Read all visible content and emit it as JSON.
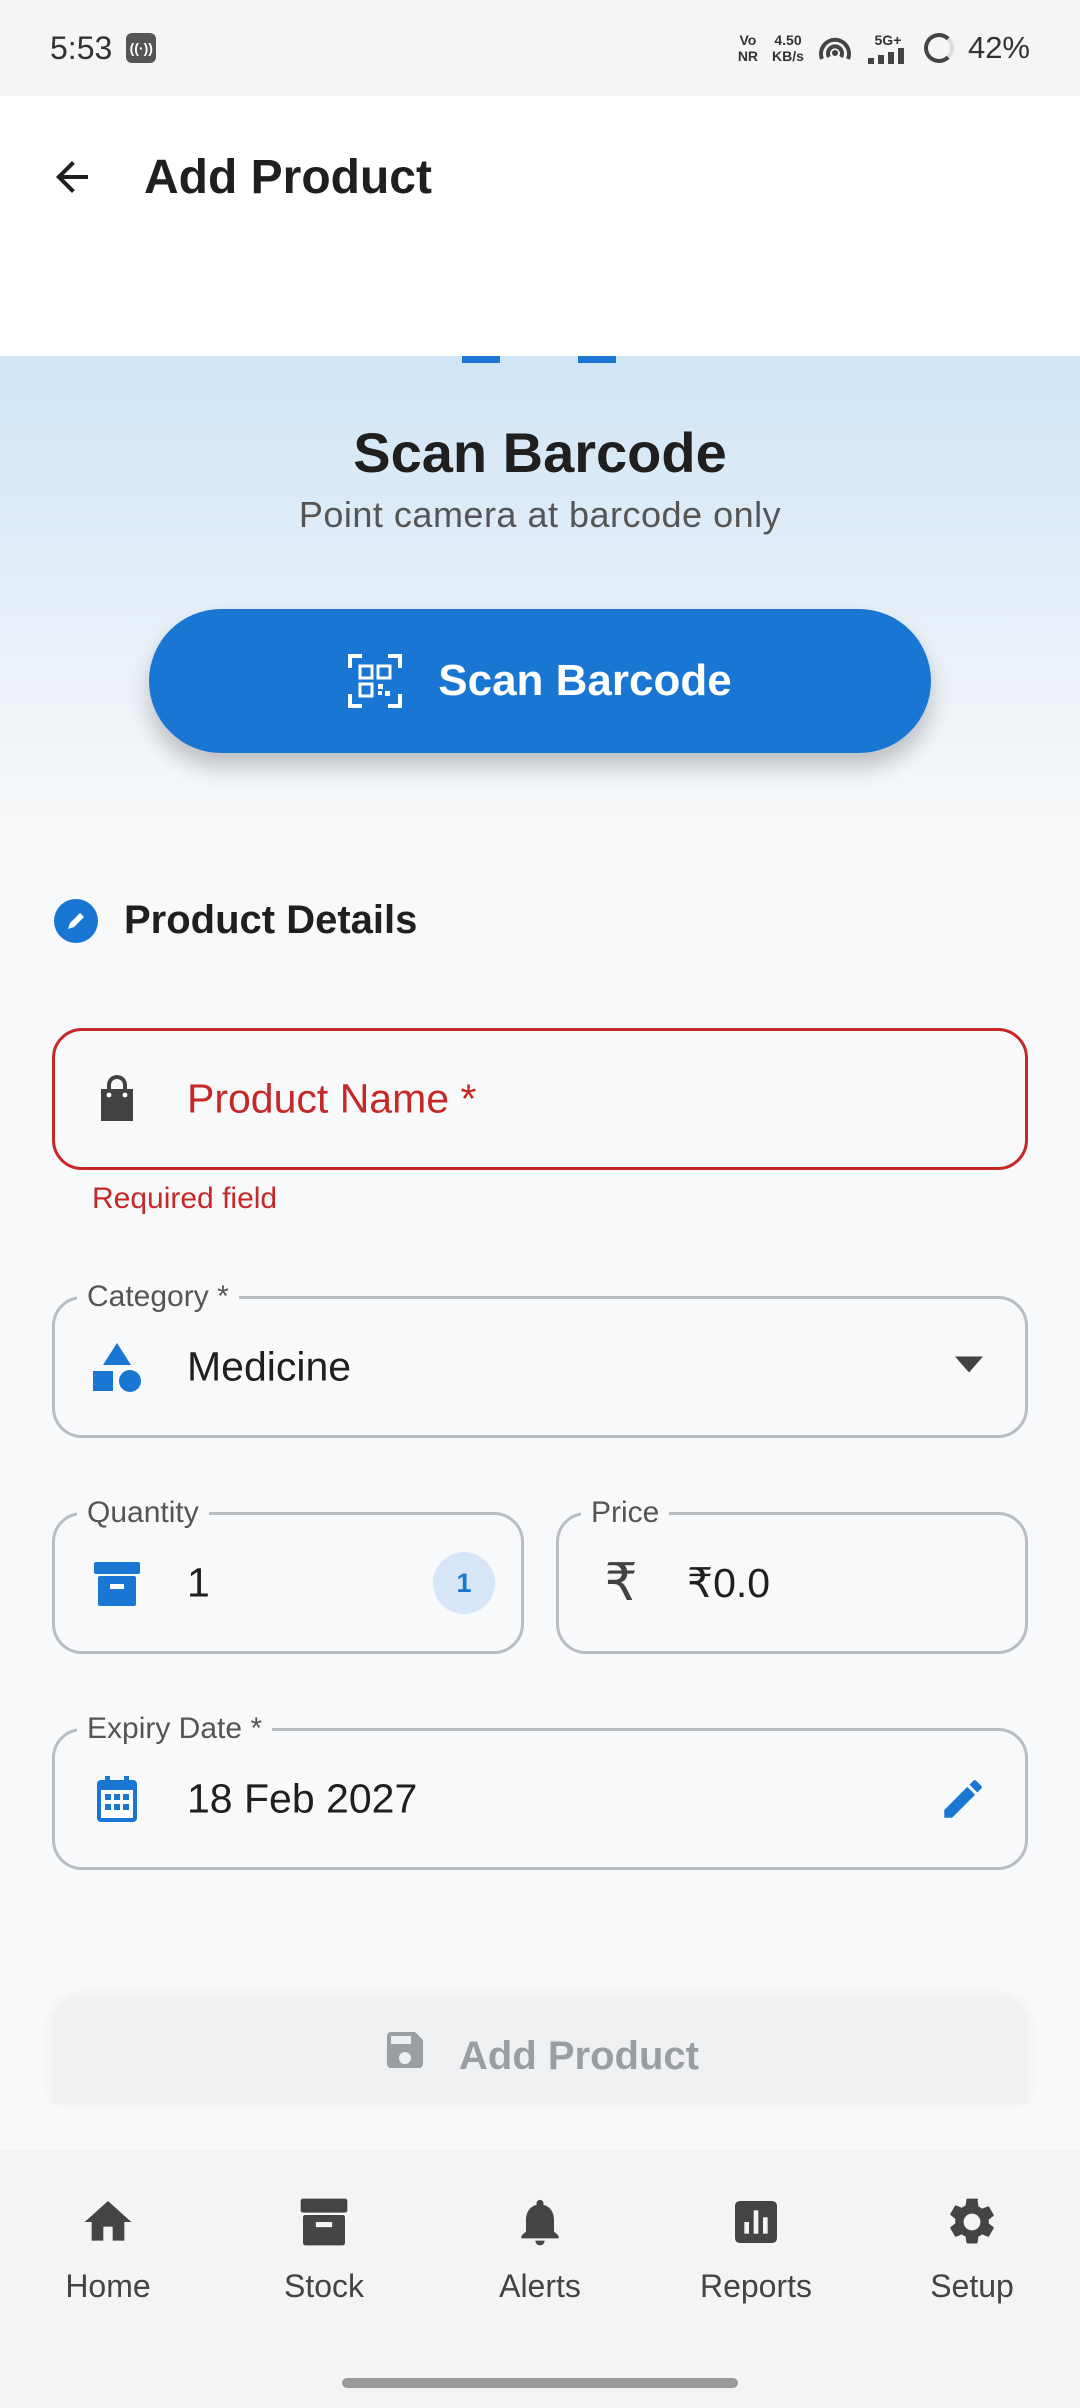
{
  "status_bar": {
    "time": "5:53",
    "network_top": "Vo",
    "network_bottom": "NR",
    "speed_value": "4.50",
    "speed_unit": "KB/s",
    "signal": "5G+",
    "battery": "42%"
  },
  "app_bar": {
    "title": "Add Product"
  },
  "scan": {
    "title": "Scan Barcode",
    "subtitle": "Point camera at barcode only",
    "button_label": "Scan Barcode"
  },
  "section": {
    "title": "Product Details"
  },
  "fields": {
    "product_name": {
      "placeholder": "Product Name *",
      "error": "Required field"
    },
    "category": {
      "label": "Category *",
      "value": "Medicine"
    },
    "quantity": {
      "label": "Quantity",
      "value": "1",
      "badge": "1"
    },
    "price": {
      "label": "Price",
      "value": "₹0.0"
    },
    "expiry": {
      "label": "Expiry Date *",
      "value": "18 Feb 2027"
    }
  },
  "add_button": {
    "label": "Add Product"
  },
  "nav": [
    {
      "label": "Home",
      "icon": "home-icon"
    },
    {
      "label": "Stock",
      "icon": "archive-icon"
    },
    {
      "label": "Alerts",
      "icon": "bell-icon"
    },
    {
      "label": "Reports",
      "icon": "bar-chart-icon"
    },
    {
      "label": "Setup",
      "icon": "gear-icon"
    }
  ],
  "colors": {
    "primary": "#1976d2",
    "error": "#c62828",
    "disabled": "#9a9ea3"
  }
}
